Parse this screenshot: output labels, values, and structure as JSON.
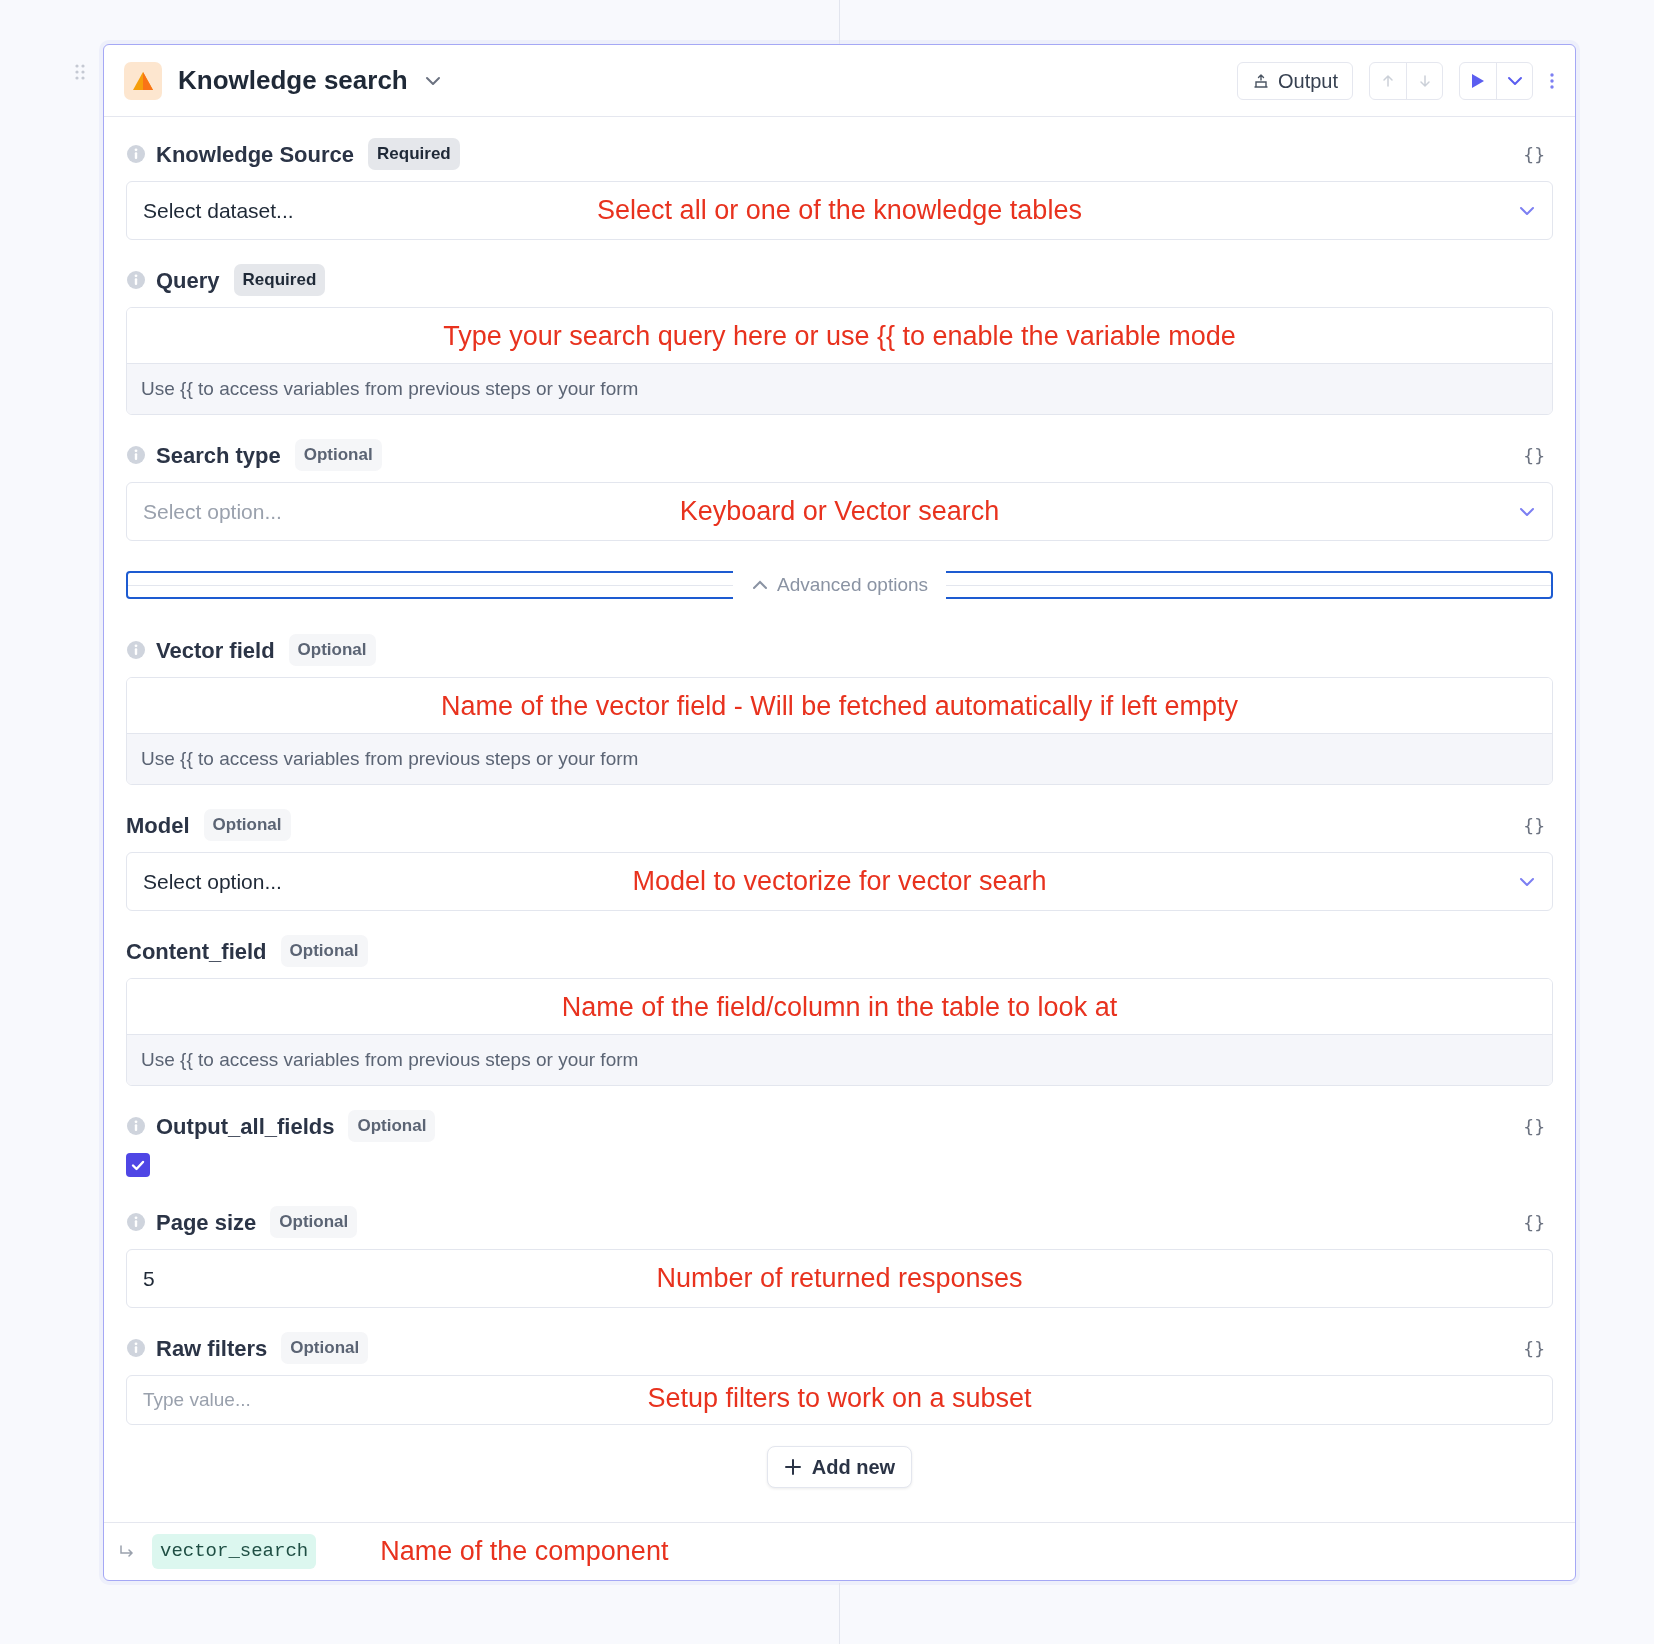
{
  "header": {
    "title": "Knowledge search",
    "output_button": "Output"
  },
  "fields": [
    {
      "kind": "select",
      "label": "Knowledge Source",
      "badge": "Required",
      "required": true,
      "info": true,
      "var_button": "{}",
      "value": "Select dataset...",
      "annotation": "Select all or one of the knowledge tables"
    },
    {
      "kind": "variable",
      "label": "Query",
      "badge": "Required",
      "required": true,
      "info": true,
      "helper": "Use {{ to access variables from previous steps or your form",
      "annotation": "Type your search query here or use {{ to enable the variable mode"
    },
    {
      "kind": "select",
      "label": "Search type",
      "badge": "Optional",
      "required": false,
      "info": true,
      "var_button": "{}",
      "placeholder": "Select option...",
      "annotation": "Keyboard or Vector search"
    }
  ],
  "advanced": {
    "label": "Advanced options",
    "expanded": true,
    "focused": true
  },
  "advanced_fields": [
    {
      "kind": "variable",
      "label": "Vector field",
      "badge": "Optional",
      "required": false,
      "info": true,
      "helper": "Use {{ to access variables from previous steps or your form",
      "annotation": "Name of the vector field - Will be fetched automatically if left empty"
    },
    {
      "kind": "select",
      "label": "Model",
      "badge": "Optional",
      "required": false,
      "info": false,
      "var_button": "{}",
      "value": "Select option...",
      "annotation": "Model to vectorize for vector searh"
    },
    {
      "kind": "variable",
      "label": "Content_field",
      "badge": "Optional",
      "required": false,
      "info": false,
      "helper": "Use {{ to access variables from previous steps or your form",
      "annotation": "Name of the field/column in the table to look at"
    },
    {
      "kind": "checkbox",
      "label": "Output_all_fields",
      "badge": "Optional",
      "required": false,
      "info": true,
      "var_button": "{}",
      "checked": true
    },
    {
      "kind": "text",
      "label": "Page size",
      "badge": "Optional",
      "required": false,
      "info": true,
      "var_button": "{}",
      "value": "5",
      "annotation": "Number of returned responses"
    },
    {
      "kind": "text",
      "label": "Raw filters",
      "badge": "Optional",
      "required": false,
      "info": true,
      "var_button": "{}",
      "placeholder": "Type value...",
      "annotation": "Setup filters to work on a subset"
    }
  ],
  "add_button": "Add new",
  "footer": {
    "output_name": "vector_search",
    "annotation": "Name of the component"
  }
}
